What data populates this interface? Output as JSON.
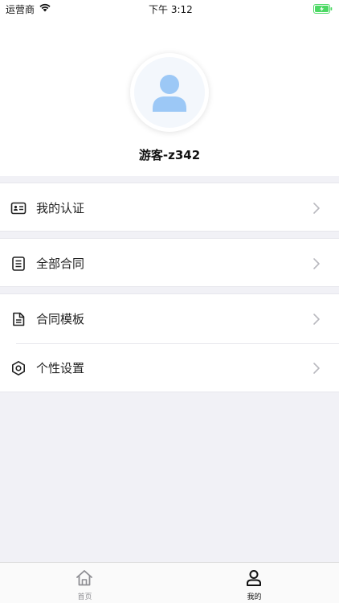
{
  "status_bar": {
    "carrier": "运营商",
    "time": "下午 3:12"
  },
  "profile": {
    "username": "游客-z342"
  },
  "menu": [
    {
      "label": "我的认证",
      "icon": "id-card-icon"
    },
    {
      "label": "全部合同",
      "icon": "document-list-icon"
    },
    {
      "label": "合同模板",
      "icon": "file-icon"
    },
    {
      "label": "个性设置",
      "icon": "hexagon-settings-icon"
    }
  ],
  "tab_bar": {
    "tabs": [
      {
        "label": "首页",
        "icon": "home-icon",
        "active": false
      },
      {
        "label": "我的",
        "icon": "person-icon",
        "active": true
      }
    ]
  },
  "colors": {
    "avatar_fill": "#9cc8f6",
    "battery_green": "#4cd964",
    "page_background": "#f1f1f6"
  }
}
